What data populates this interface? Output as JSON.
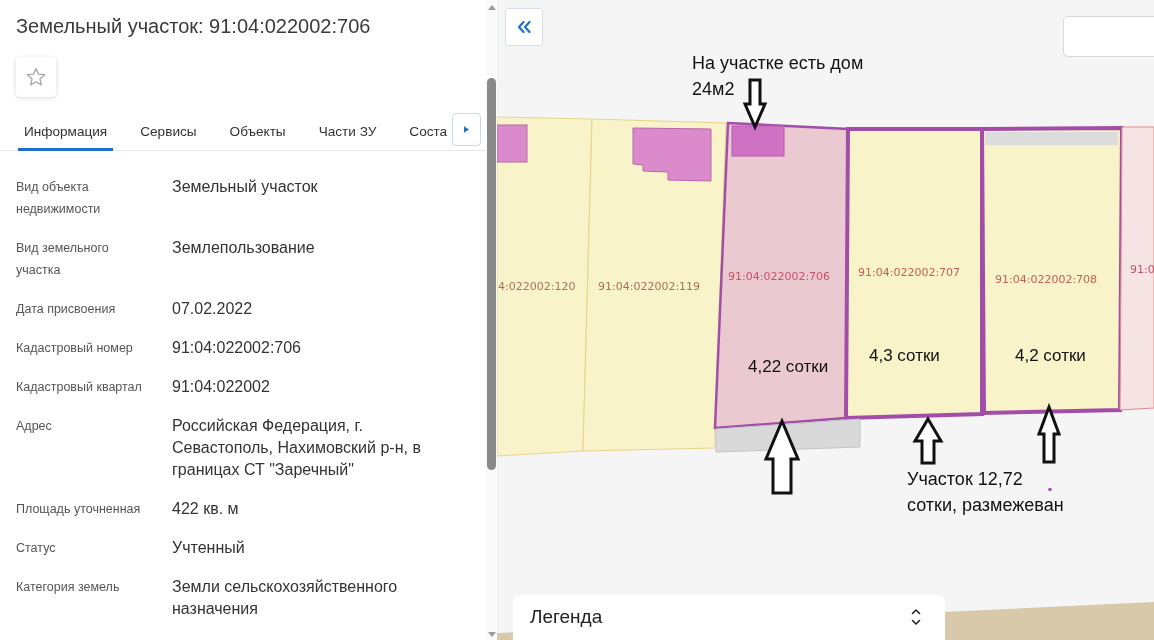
{
  "panel": {
    "title": "Земельный участок: 91:04:022002:706"
  },
  "tabs": [
    {
      "label": "Информация",
      "selected": true
    },
    {
      "label": "Сервисы",
      "selected": false
    },
    {
      "label": "Объекты",
      "selected": false
    },
    {
      "label": "Части ЗУ",
      "selected": false
    },
    {
      "label": "Соста",
      "selected": false
    }
  ],
  "properties": [
    {
      "label": "Вид объекта недвижимости",
      "value": "Земельный участок"
    },
    {
      "label": "Вид земельного участка",
      "value": "Землепользование"
    },
    {
      "label": "Дата присвоения",
      "value": "07.02.2022"
    },
    {
      "label": "Кадастровый номер",
      "value": "91:04:022002:706"
    },
    {
      "label": "Кадастровый квартал",
      "value": "91:04:022002"
    },
    {
      "label": "Адрес",
      "value": "Российская Федерация, г. Севастополь, Нахимовский р-н, в границах СТ \"Заречный\""
    },
    {
      "label": "Площадь уточненная",
      "value": "422 кв. м"
    },
    {
      "label": "Статус",
      "value": "Учтенный"
    },
    {
      "label": "Категория земель",
      "value": "Земли сельскохозяйственного назначения"
    }
  ],
  "map": {
    "parcels": [
      {
        "kind": "neighbor",
        "label": "4:022002:120"
      },
      {
        "kind": "neighbor",
        "label": "91:04:022002:119"
      },
      {
        "kind": "selected",
        "label": "91:04:022002:706",
        "area": "4,22 сотки"
      },
      {
        "kind": "outlined",
        "label": "91:04:022002:707",
        "area": "4,3 сотки"
      },
      {
        "kind": "outlined",
        "label": "91:04:022002:708",
        "area": "4,2 сотки"
      },
      {
        "kind": "other",
        "label": "91:0"
      }
    ],
    "notes": [
      {
        "lines": [
          "На участке есть дом",
          "24м2"
        ]
      },
      {
        "lines": [
          "Участок 12,72",
          "сотки, размежеван"
        ]
      }
    ],
    "legend": {
      "label": "Легенда"
    }
  }
}
